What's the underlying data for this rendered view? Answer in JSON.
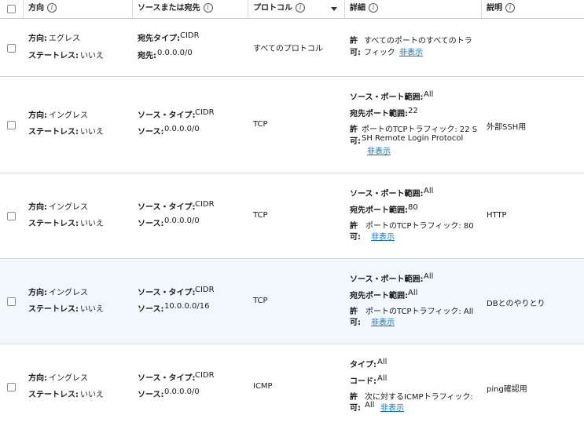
{
  "header": {
    "direction": "方向",
    "source_dest": "ソースまたは宛先",
    "protocol": "プロトコル",
    "details": "詳細",
    "description": "説明",
    "info_glyph": "i"
  },
  "rows": [
    {
      "dir_label": "方向:",
      "dir_value": "エグレス",
      "stateless_label": "ステートレス:",
      "stateless_value": "いいえ",
      "src_type_label": "宛先タイプ:",
      "src_type_value": "CIDR",
      "src_label": "宛先:",
      "src_value": "0.0.0.0/0",
      "protocol": "すべてのプロトコル",
      "allow_l1": "許",
      "allow_l2": "可:",
      "allow_text_1": "すべてのポートのすべてのトラ",
      "allow_text_2": "フィック",
      "hide": "非表示",
      "description": ""
    },
    {
      "dir_label": "方向:",
      "dir_value": "イングレス",
      "stateless_label": "ステートレス:",
      "stateless_value": "いいえ",
      "src_type_label": "ソース・タイプ:",
      "src_type_value": "CIDR",
      "src_label": "ソース:",
      "src_value": "0.0.0.0/0",
      "protocol": "TCP",
      "d1_label": "ソース・ポート範囲:",
      "d1_value": "All",
      "d2_label": "宛先ポート範囲:",
      "d2_value": "22",
      "allow_l1": "許",
      "allow_l2": "可:",
      "allow_text_1": "ポートのTCPトラフィック: 22 S",
      "allow_text_2": "SH Remote Login Protocol",
      "hide": "非表示",
      "description": "外部SSH用"
    },
    {
      "dir_label": "方向:",
      "dir_value": "イングレス",
      "stateless_label": "ステートレス:",
      "stateless_value": "いいえ",
      "src_type_label": "ソース・タイプ:",
      "src_type_value": "CIDR",
      "src_label": "ソース:",
      "src_value": "0.0.0.0/0",
      "protocol": "TCP",
      "d1_label": "ソース・ポート範囲:",
      "d1_value": "All",
      "d2_label": "宛先ポート範囲:",
      "d2_value": "80",
      "allow_l1": "許",
      "allow_l2": "可:",
      "allow_text_1": "ポートのTCPトラフィック: 80",
      "hide": "非表示",
      "description": "HTTP"
    },
    {
      "dir_label": "方向:",
      "dir_value": "イングレス",
      "stateless_label": "ステートレス:",
      "stateless_value": "いいえ",
      "src_type_label": "ソース・タイプ:",
      "src_type_value": "CIDR",
      "src_label": "ソース:",
      "src_value": "10.0.0.0/16",
      "protocol": "TCP",
      "d1_label": "ソース・ポート範囲:",
      "d1_value": "All",
      "d2_label": "宛先ポート範囲:",
      "d2_value": "All",
      "allow_l1": "許",
      "allow_l2": "可:",
      "allow_text_1": "ポートのTCPトラフィック: All",
      "hide": "非表示",
      "description": "DBとのやりとり"
    },
    {
      "dir_label": "方向:",
      "dir_value": "イングレス",
      "stateless_label": "ステートレス:",
      "stateless_value": "いいえ",
      "src_type_label": "ソース・タイプ:",
      "src_type_value": "CIDR",
      "src_label": "ソース:",
      "src_value": "0.0.0.0/0",
      "protocol": "ICMP",
      "d1_label": "タイプ:",
      "d1_value": "All",
      "d2_label": "コード:",
      "d2_value": "All",
      "allow_l1": "許",
      "allow_l2": "可:",
      "allow_text_1": "次に対するICMPトラフィック:",
      "allow_text_2": "All",
      "hide": "非表示",
      "description": "ping確認用"
    }
  ]
}
